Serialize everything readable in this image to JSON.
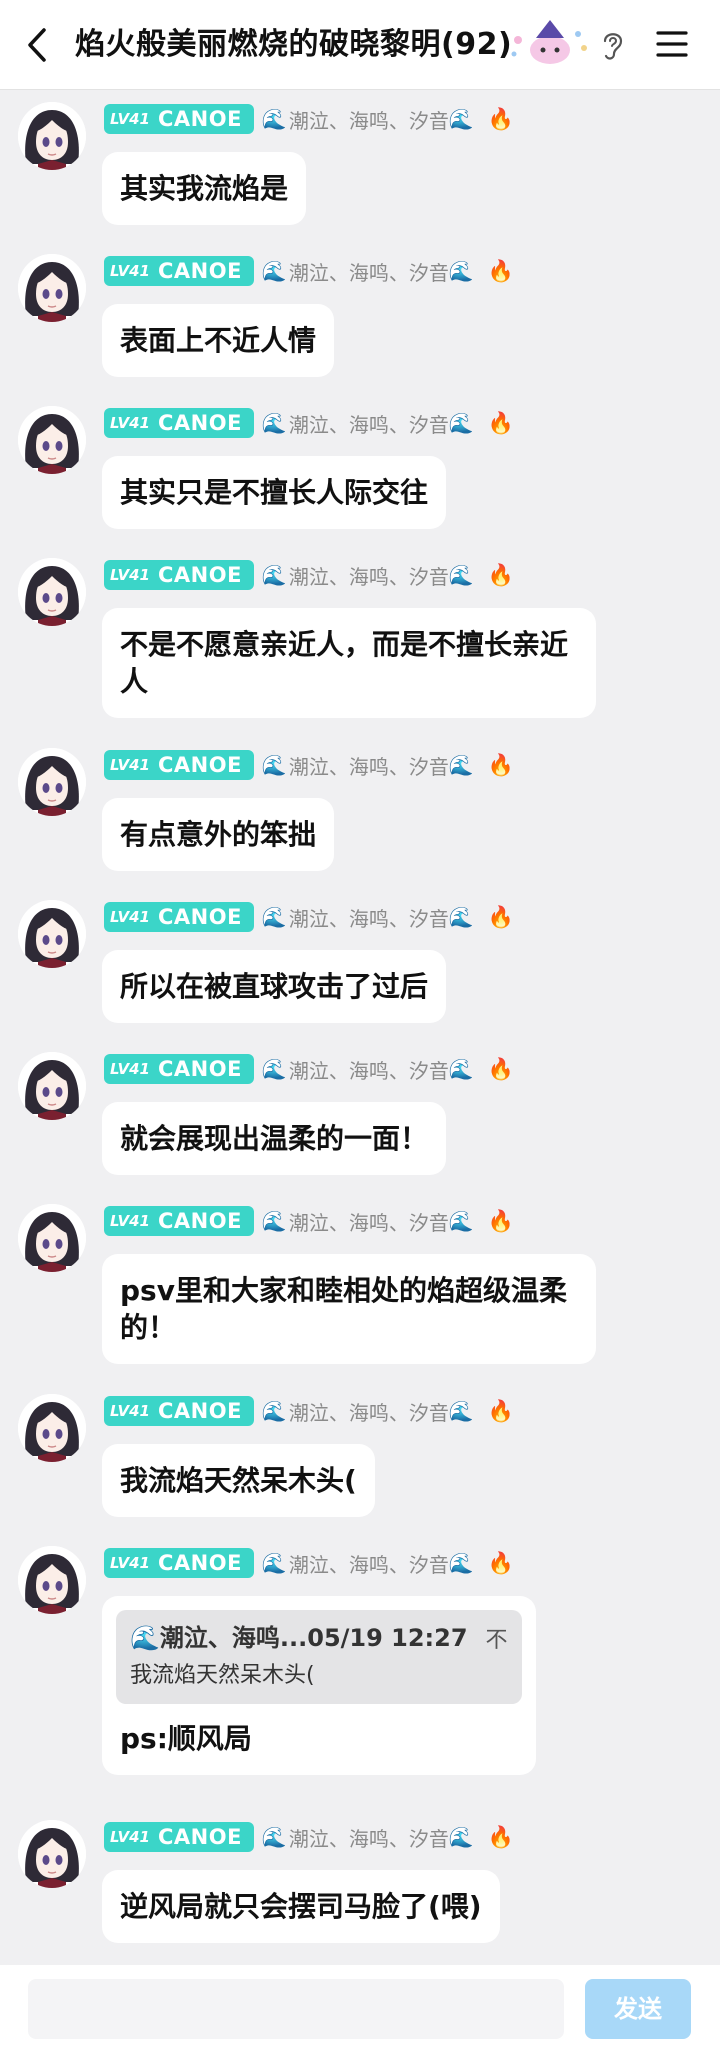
{
  "header": {
    "title": "焰火般美丽燃烧的破晓黎明(92)"
  },
  "sender": {
    "level_badge": "LV41",
    "name": "CANOE",
    "wave_emoji": "🌊",
    "fans_text": "潮泣、海鸣、汐音",
    "fire_emoji": "🔥"
  },
  "messages": [
    {
      "text": "其实我流焰是"
    },
    {
      "text": "表面上不近人情"
    },
    {
      "text": "其实只是不擅长人际交往"
    },
    {
      "text": "不是不愿意亲近人，而是不擅长亲近人"
    },
    {
      "text": "有点意外的笨拙"
    },
    {
      "text": "所以在被直球攻击了过后"
    },
    {
      "text": "就会展现出温柔的一面！"
    },
    {
      "text": "psv里和大家和睦相处的焰超级温柔的！"
    },
    {
      "text": "我流焰天然呆木头("
    },
    {
      "quote_wave": "🌊",
      "quote_header": "潮泣、海鸣...05/19 12:27",
      "quote_fold": "不",
      "quote_text": "我流焰天然呆木头(",
      "text": "ps:顺风局"
    },
    {
      "text": "逆风局就只会摆司马脸了(喂)"
    }
  ],
  "footer": {
    "input_placeholder": "",
    "send_label": "发送"
  }
}
